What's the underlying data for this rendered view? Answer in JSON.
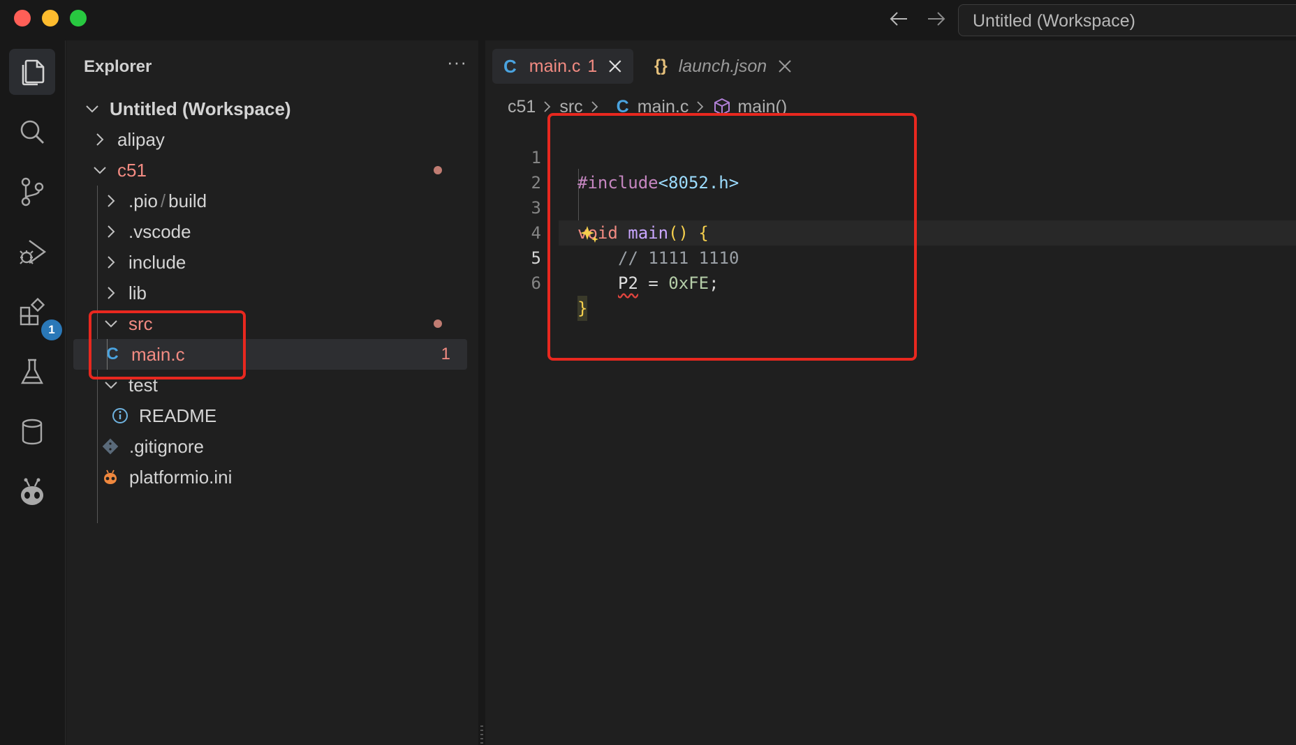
{
  "window": {
    "title": "Untitled (Workspace)"
  },
  "activity": {
    "extensions_badge": "1"
  },
  "explorer": {
    "title": "Explorer",
    "more": "···",
    "workspace": "Untitled (Workspace)",
    "items": [
      {
        "label": "alipay"
      },
      {
        "label": "c51"
      },
      {
        "label": ".pio"
      },
      {
        "label": "build"
      },
      {
        "label": ".vscode"
      },
      {
        "label": "include"
      },
      {
        "label": "lib"
      },
      {
        "label": "src"
      },
      {
        "label": "main.c",
        "problems": "1"
      },
      {
        "label": "test"
      },
      {
        "label": "README"
      },
      {
        "label": ".gitignore"
      },
      {
        "label": "platformio.ini"
      }
    ],
    "path_sep": "/"
  },
  "tabs": [
    {
      "label": "main.c",
      "problems": "1",
      "icon": "C"
    },
    {
      "label": "launch.json",
      "icon": "{}"
    }
  ],
  "breadcrumb": {
    "parts": [
      "c51",
      "src",
      "main.c",
      "main()"
    ],
    "file_icon": "C"
  },
  "code": {
    "line_numbers": [
      "1",
      "2",
      "3",
      "4",
      "5",
      "6"
    ],
    "l1_pp": "#include",
    "l1_file": "<8052.h>",
    "l3_type": "void",
    "l3_fn": "main",
    "l3_parens": "()",
    "l3_brace": "{",
    "l4_comment": "// 1111 1110",
    "l5_ident": "P2",
    "l5_op": " = ",
    "l5_num": "0xFE",
    "l5_semi": ";",
    "l6_brace": "}"
  },
  "colors": {
    "modified": "#f28b82",
    "c_icon": "#4aa3df",
    "annotation": "#e8281f"
  }
}
